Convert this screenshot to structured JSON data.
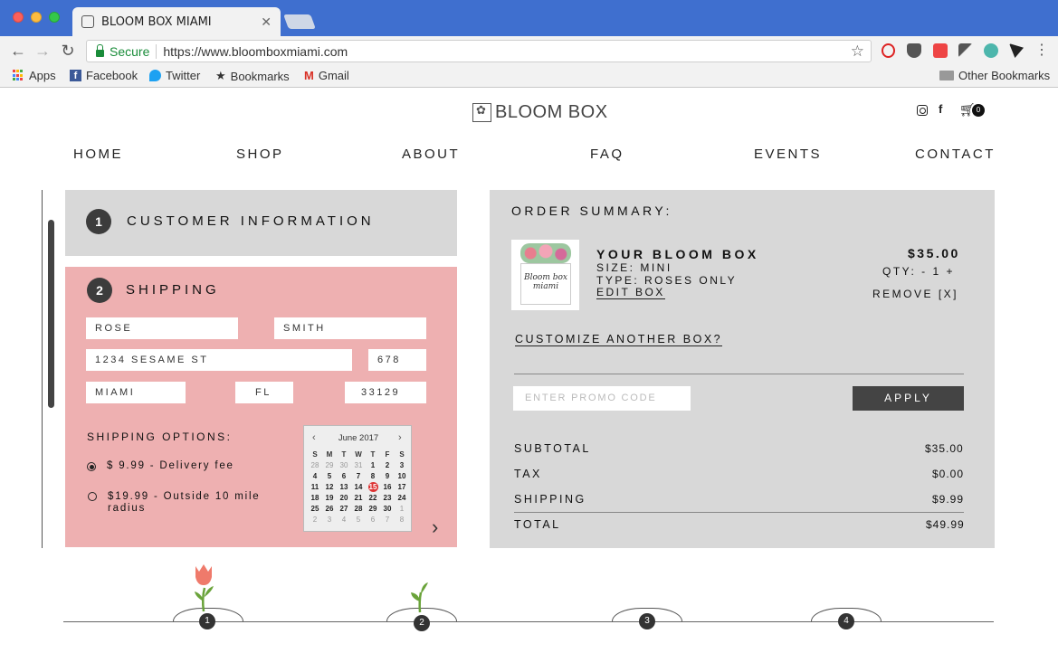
{
  "browser": {
    "tab_title": "BLOOM BOX MIAMI",
    "secure_label": "Secure",
    "url": "https://www.bloomboxmiami.com",
    "bookmarks": [
      "Apps",
      "Facebook",
      "Twitter",
      "Bookmarks",
      "Gmail"
    ],
    "other_bookmarks": "Other Bookmarks"
  },
  "site": {
    "logo_text": "BLOOM BOX",
    "cart_count": "0",
    "nav": [
      "HOME",
      "SHOP",
      "ABOUT",
      "FAQ",
      "EVENTS",
      "CONTACT"
    ]
  },
  "steps": {
    "customer": {
      "number": "1",
      "title": "CUSTOMER INFORMATION"
    },
    "shipping": {
      "number": "2",
      "title": "SHIPPING"
    }
  },
  "shipping_form": {
    "first_name": "ROSE",
    "last_name": "SMITH",
    "street": "1234 SESAME ST",
    "apt": "678",
    "city": "MIAMI",
    "state": "FL",
    "zip": "33129",
    "options_label": "SHIPPING OPTIONS:",
    "options": [
      {
        "label": "$ 9.99 - Delivery fee",
        "selected": true
      },
      {
        "label": "$19.99 - Outside 10 mile radius",
        "selected": false
      }
    ]
  },
  "calendar": {
    "month": "June 2017",
    "dows": [
      "S",
      "M",
      "T",
      "W",
      "T",
      "F",
      "S"
    ],
    "selected": "15",
    "weeks": [
      [
        "28",
        "29",
        "30",
        "31",
        "1",
        "2",
        "3"
      ],
      [
        "4",
        "5",
        "6",
        "7",
        "8",
        "9",
        "10"
      ],
      [
        "11",
        "12",
        "13",
        "14",
        "15",
        "16",
        "17"
      ],
      [
        "18",
        "19",
        "20",
        "21",
        "22",
        "23",
        "24"
      ],
      [
        "25",
        "26",
        "27",
        "28",
        "29",
        "30",
        "1"
      ],
      [
        "2",
        "3",
        "4",
        "5",
        "6",
        "7",
        "8"
      ]
    ]
  },
  "summary": {
    "title": "ORDER SUMMARY:",
    "item_name": "YOUR BLOOM BOX",
    "size": "SIZE: MINI",
    "type": "TYPE: ROSES ONLY",
    "edit": "EDIT BOX",
    "price": "$35.00",
    "qty": "QTY: - 1 +",
    "remove": "REMOVE [X]",
    "thumb_text": "Bloom box miami",
    "customize": "CUSTOMIZE ANOTHER BOX?",
    "promo_placeholder": "ENTER PROMO CODE",
    "apply": "APPLY",
    "rows": [
      {
        "label": "SUBTOTAL",
        "value": "$35.00"
      },
      {
        "label": "TAX",
        "value": "$0.00"
      },
      {
        "label": "SHIPPING",
        "value": "$9.99"
      },
      {
        "label": "TOTAL",
        "value": "$49.99"
      }
    ]
  },
  "progress": [
    "1",
    "2",
    "3",
    "4"
  ]
}
